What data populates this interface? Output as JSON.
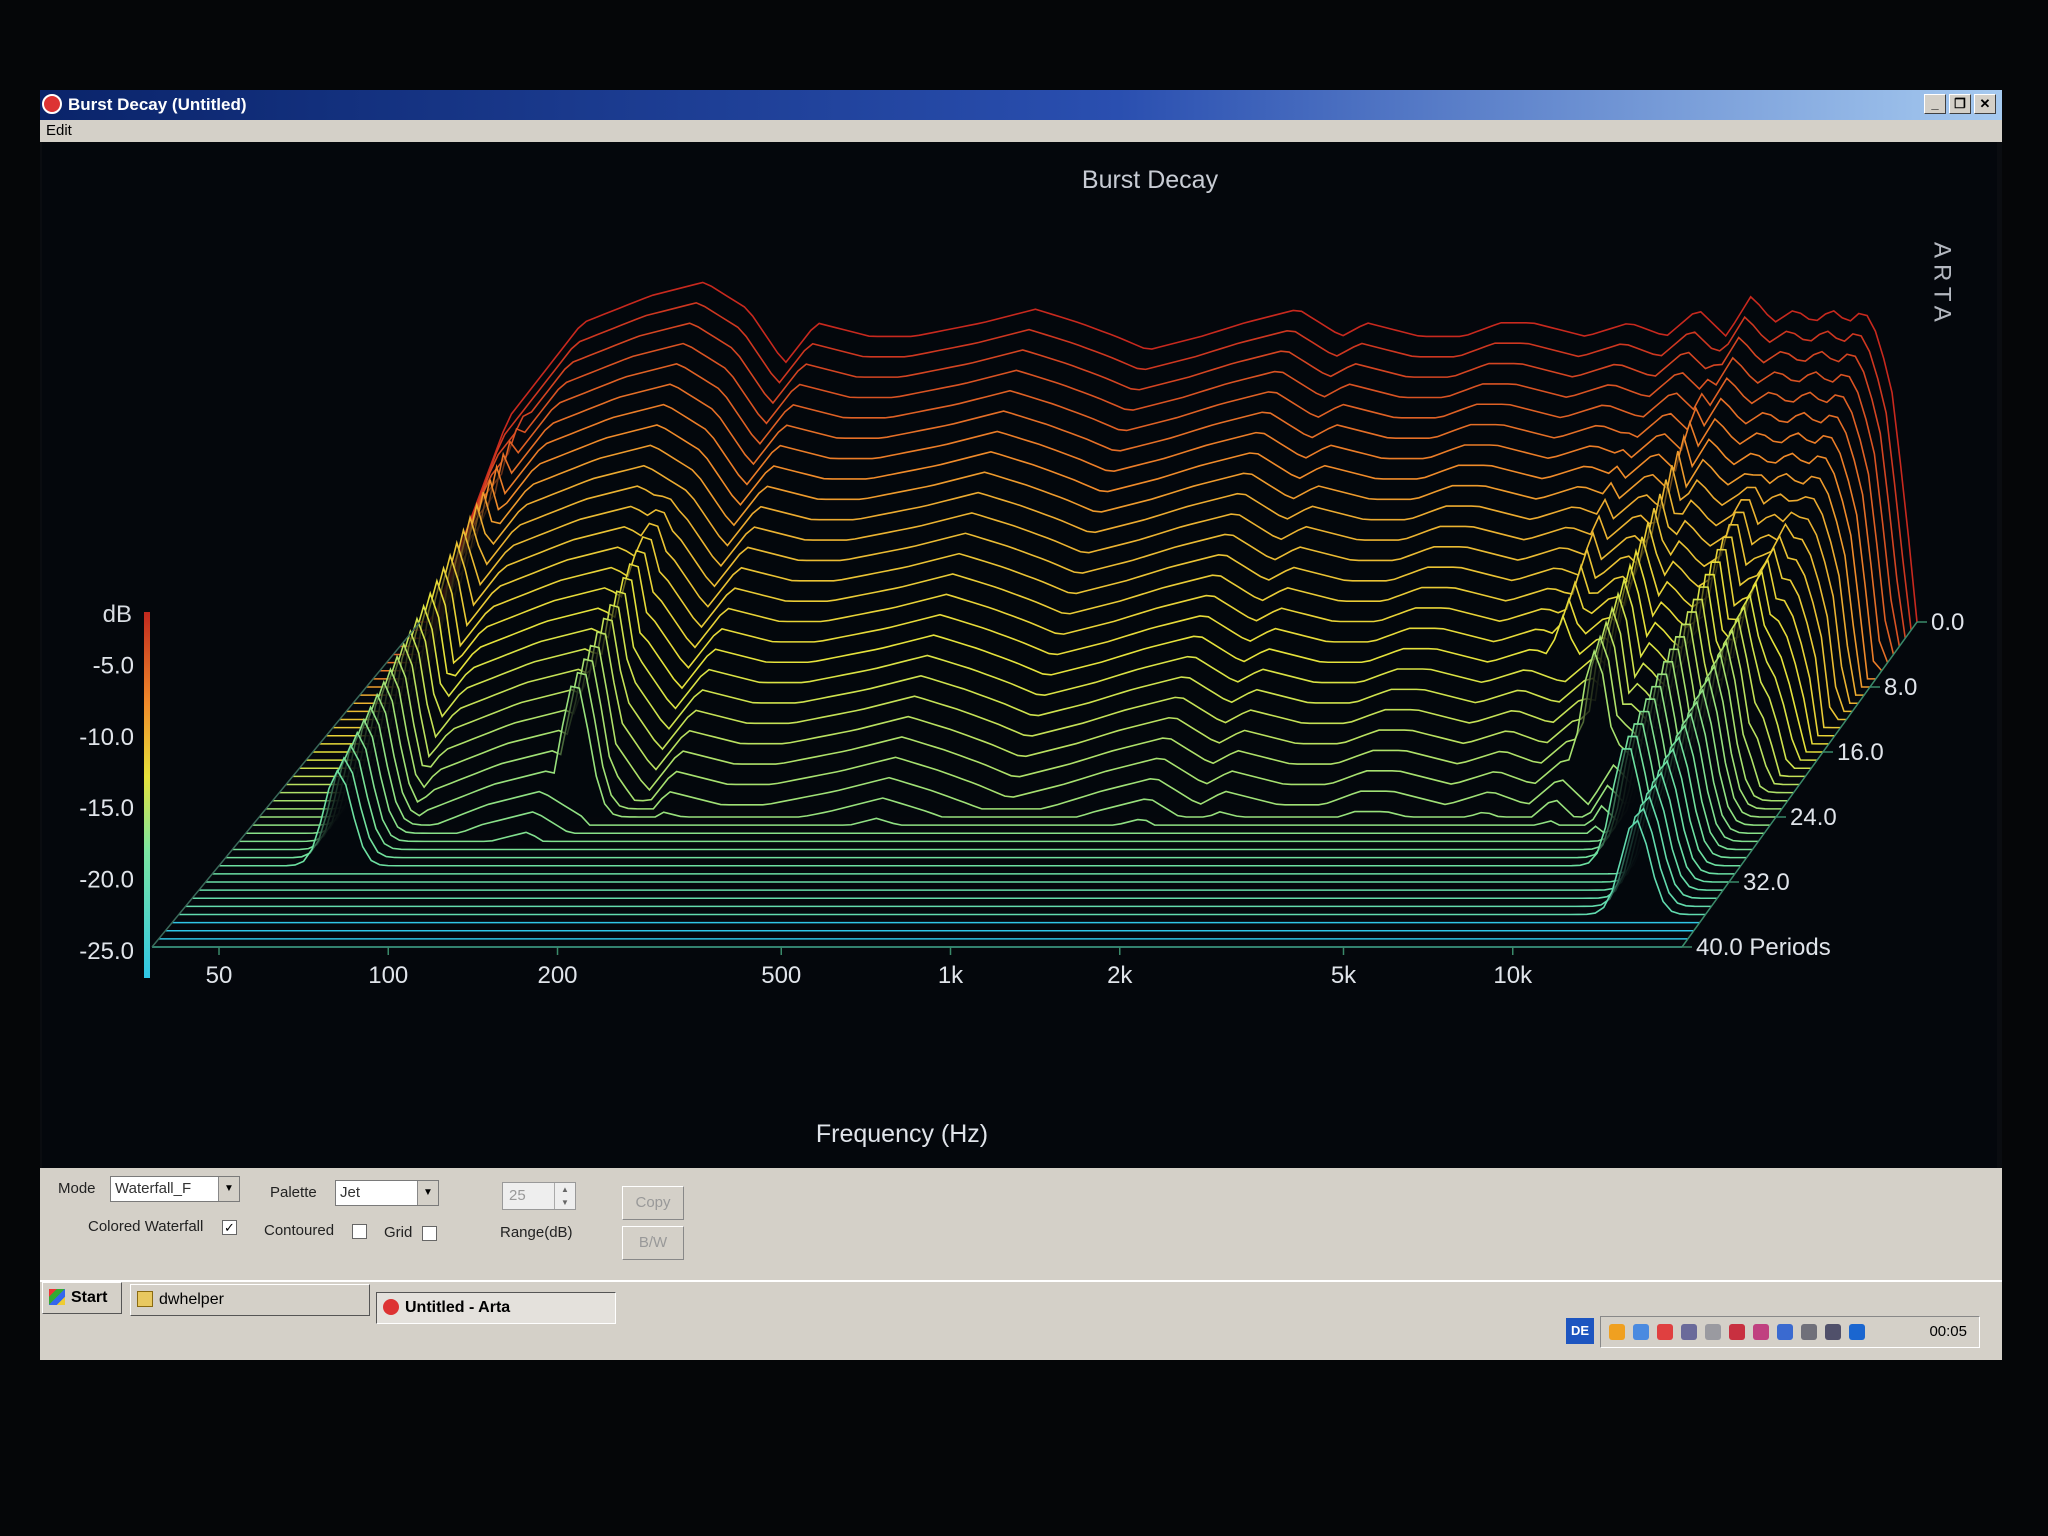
{
  "window": {
    "title": "Burst Decay  (Untitled)",
    "buttons": {
      "minimize": "_",
      "maximize": "❐",
      "close": "✕"
    }
  },
  "menu": {
    "edit": "Edit"
  },
  "chart_data": {
    "type": "waterfall",
    "title": "Burst Decay",
    "watermark": "ARTA",
    "xlabel": "Frequency (Hz)",
    "xscale": "log",
    "x_ticks": [
      "50",
      "100",
      "200",
      "500",
      "1k",
      "2k",
      "5k",
      "10k"
    ],
    "x_tick_values": [
      50,
      100,
      200,
      500,
      1000,
      2000,
      5000,
      10000
    ],
    "xlim": [
      38,
      20000
    ],
    "ylabel": "dB",
    "y_ticks": [
      "-5.0",
      "-10.0",
      "-15.0",
      "-20.0",
      "-25.0"
    ],
    "ylim": [
      -25,
      0
    ],
    "z_ticks": [
      "0.0",
      "8.0",
      "16.0",
      "24.0",
      "32.0",
      "40.0 Periods"
    ],
    "zlim": [
      0,
      40
    ],
    "palette": "Jet",
    "slices": 40,
    "front_slice_level_db": -25,
    "response_db": {
      "freq_hz": [
        40,
        55,
        75,
        100,
        125,
        150,
        175,
        200,
        250,
        300,
        400,
        500,
        600,
        700,
        800,
        1000,
        1200,
        1500,
        1800,
        2000,
        2500,
        3000,
        3500,
        4000,
        5000,
        6000,
        7000,
        8000,
        9000,
        10000,
        11000,
        12000,
        13000,
        14000,
        15000,
        16000,
        17000,
        18000,
        19000,
        20000
      ],
      "db": [
        -25,
        -10,
        -3,
        -1,
        0,
        -2,
        -6,
        -3,
        -4,
        -4,
        -3,
        -2,
        -3,
        -4,
        -5,
        -4,
        -3,
        -2,
        -4,
        -3,
        -4,
        -4,
        -3,
        -3,
        -4,
        -3,
        -4,
        -2,
        -4,
        -1,
        -3,
        -2,
        -3,
        -2,
        -3,
        -2,
        -4,
        -8,
        -16,
        -25
      ]
    },
    "decay_ridges": [
      {
        "freq_hz": 62,
        "db": -8,
        "sustain_periods": 30
      },
      {
        "freq_hz": 140,
        "db": -5,
        "sustain_periods": 24
      },
      {
        "freq_hz": 2400,
        "db": -12,
        "sustain_periods": 6
      },
      {
        "freq_hz": 4500,
        "db": -14,
        "sustain_periods": 6
      },
      {
        "freq_hz": 6800,
        "db": -5,
        "sustain_periods": 16
      },
      {
        "freq_hz": 9000,
        "db": -4,
        "sustain_periods": 22
      },
      {
        "freq_hz": 12500,
        "db": -6,
        "sustain_periods": 30
      },
      {
        "freq_hz": 15000,
        "db": -8,
        "sustain_periods": 36
      }
    ]
  },
  "controls": {
    "mode_label": "Mode",
    "mode_value": "Waterfall_F",
    "palette_label": "Palette",
    "palette_value": "Jet",
    "range_value": "25",
    "range_label": "Range(dB)",
    "copy_label": "Copy",
    "bw_label": "B/W",
    "colored_waterfall_label": "Colored Waterfall",
    "colored_waterfall_checked": true,
    "contoured_label": "Contoured",
    "contoured_checked": false,
    "grid_label": "Grid",
    "grid_checked": false
  },
  "taskbar": {
    "start_label": "Start",
    "items": [
      "dwhelper",
      "Untitled - Arta"
    ],
    "lang": "DE",
    "clock": "00:05"
  }
}
